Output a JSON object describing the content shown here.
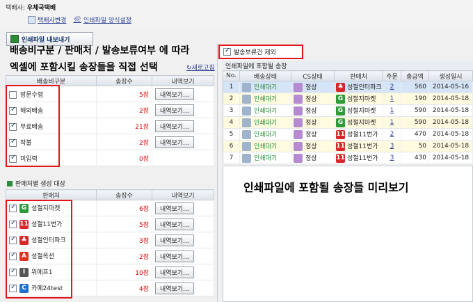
{
  "carrier": {
    "label": "택배사:",
    "name": "우체국택배"
  },
  "links": {
    "change_carrier": "택배사변경",
    "print_settings": "인쇄파일 양식설정"
  },
  "export_button": "인쇄파일 내보내기",
  "annotations": {
    "left_line1": "배송비구분 / 판매처 / 발송보류여부 에 따라",
    "left_line2": "엑셀에 포함시킬 송장들을 직접 선택",
    "right": "인쇄파일에 포함될 송장들 미리보기"
  },
  "refresh": "새로고침",
  "shipping_table": {
    "headers": [
      "배송비구분",
      "송장수",
      "내역보기"
    ],
    "rows": [
      {
        "checked": false,
        "name": "방문수령",
        "count": "5장",
        "button": "내역보기..."
      },
      {
        "checked": true,
        "name": "해외배송",
        "count": "2장",
        "button": "내역보기..."
      },
      {
        "checked": true,
        "name": "무료배송",
        "count": "21장",
        "button": "내역보기..."
      },
      {
        "checked": true,
        "name": "착불",
        "count": "2장",
        "button": "내역보기..."
      },
      {
        "checked": true,
        "name": "미입력",
        "count": "0장",
        "button": ""
      }
    ]
  },
  "seller_section_title": "판매처별 생성 대상",
  "seller_table": {
    "headers": [
      "판매처",
      "송장수",
      "내역보기"
    ],
    "rows": [
      {
        "checked": true,
        "icon": "G",
        "icon_color": "#2e9a3a",
        "name": "성철지마켓",
        "count": "6장",
        "button": "내역보기..."
      },
      {
        "checked": true,
        "icon": "11",
        "icon_color": "#d6272b",
        "name": "성철11번가",
        "count": "5장",
        "button": "내역보기..."
      },
      {
        "checked": true,
        "icon": "♣",
        "icon_color": "#d6272b",
        "name": "성철인터파크",
        "count": "3장",
        "button": "내역보기..."
      },
      {
        "checked": true,
        "icon": "A",
        "icon_color": "#e0301e",
        "name": "성철옥션",
        "count": "2장",
        "button": "내역보기..."
      },
      {
        "checked": true,
        "icon": "I",
        "icon_color": "#555555",
        "name": "위메프1",
        "count": "10장",
        "button": "내역보기..."
      },
      {
        "checked": true,
        "icon": "C",
        "icon_color": "#1e6fd0",
        "name": "카페24test",
        "count": "4장",
        "button": "내역보기..."
      }
    ]
  },
  "hold_checkbox": {
    "label": "발송보류건 제외",
    "checked": true
  },
  "preview_title": "인쇄파일에 포함될 송장",
  "preview_table": {
    "headers": [
      "No.",
      "배송상태",
      "CS상태",
      "판매처",
      "주문",
      "총금액",
      "생성일시"
    ],
    "rows": [
      {
        "no": "1",
        "status": "인쇄대기",
        "cs": "정상",
        "seller_icon": "♣",
        "seller_color": "#d6272b",
        "seller": "성철인터파크",
        "orders": "2",
        "amount": "560",
        "date": "2014-05-16"
      },
      {
        "no": "2",
        "status": "인쇄대기",
        "cs": "정상",
        "seller_icon": "G",
        "seller_color": "#2e9a3a",
        "seller": "성철지마켓",
        "orders": "1",
        "amount": "190",
        "date": "2014-05-18"
      },
      {
        "no": "3",
        "status": "인쇄대기",
        "cs": "정상",
        "seller_icon": "G",
        "seller_color": "#2e9a3a",
        "seller": "성철지마켓",
        "orders": "1",
        "amount": "590",
        "date": "2014-05-18"
      },
      {
        "no": "4",
        "status": "인쇄대기",
        "cs": "정상",
        "seller_icon": "G",
        "seller_color": "#2e9a3a",
        "seller": "성철지마켓",
        "orders": "1",
        "amount": "590",
        "date": "2014-05-18"
      },
      {
        "no": "5",
        "status": "인쇄대기",
        "cs": "정상",
        "seller_icon": "11",
        "seller_color": "#d6272b",
        "seller": "성철11번가",
        "orders": "2",
        "amount": "470",
        "date": "2014-05-18"
      },
      {
        "no": "6",
        "status": "인쇄대기",
        "cs": "정상",
        "seller_icon": "11",
        "seller_color": "#d6272b",
        "seller": "성철11번가",
        "orders": "3",
        "amount": "50",
        "date": "2014-05-18"
      },
      {
        "no": "7",
        "status": "인쇄대기",
        "cs": "정상",
        "seller_icon": "11",
        "seller_color": "#d6272b",
        "seller": "성철11번가",
        "orders": "3",
        "amount": "430",
        "date": "2014-05-18"
      }
    ]
  }
}
